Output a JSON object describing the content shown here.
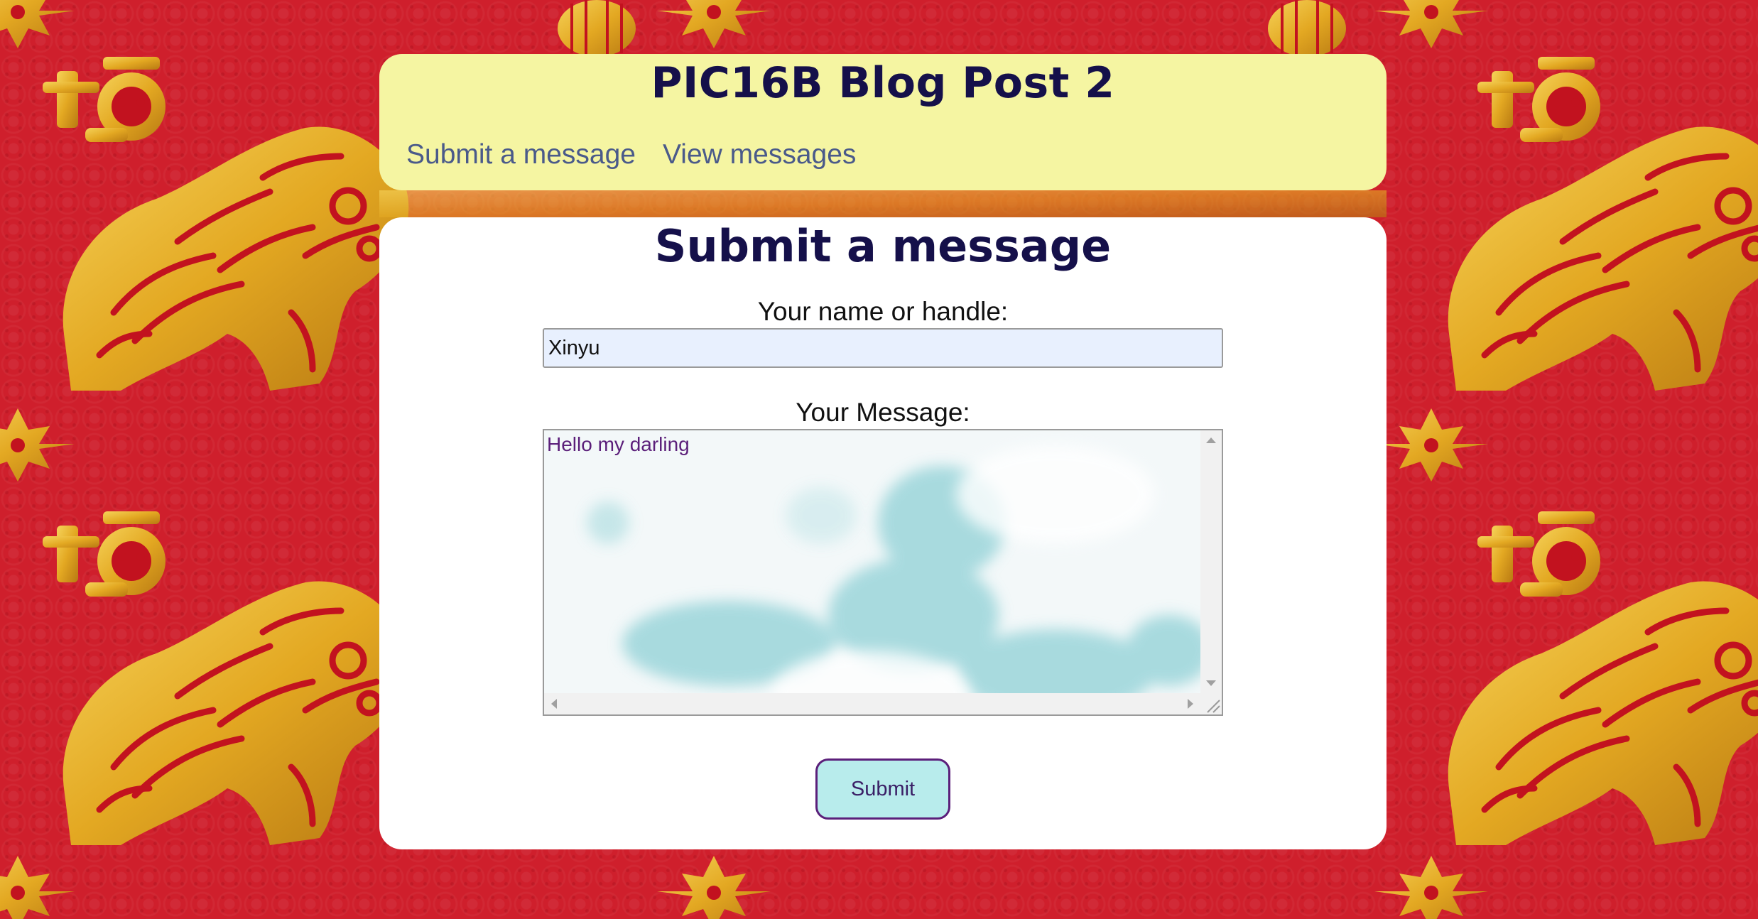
{
  "header": {
    "title": "PIC16B Blog Post 2",
    "nav": [
      {
        "label": "Submit a message"
      },
      {
        "label": "View messages"
      }
    ]
  },
  "form": {
    "heading": "Submit a message",
    "name_label": "Your name or handle:",
    "name_value": "Xinyu",
    "message_label": "Your Message:",
    "message_value": "Hello my darling",
    "submit_label": "Submit"
  },
  "theme": {
    "background": "#cf1f2c",
    "gold": "#e8b22a",
    "header_bg": "#f5f5a2",
    "title_color": "#15104a",
    "nav_color": "#4a5a8a",
    "button_bg": "#b8ecec",
    "button_border": "#5b1f7a"
  },
  "icons": {
    "scroll_up": "triangle-up",
    "scroll_down": "triangle-down",
    "scroll_left": "triangle-left",
    "scroll_right": "triangle-right",
    "resize": "resize-grip"
  }
}
